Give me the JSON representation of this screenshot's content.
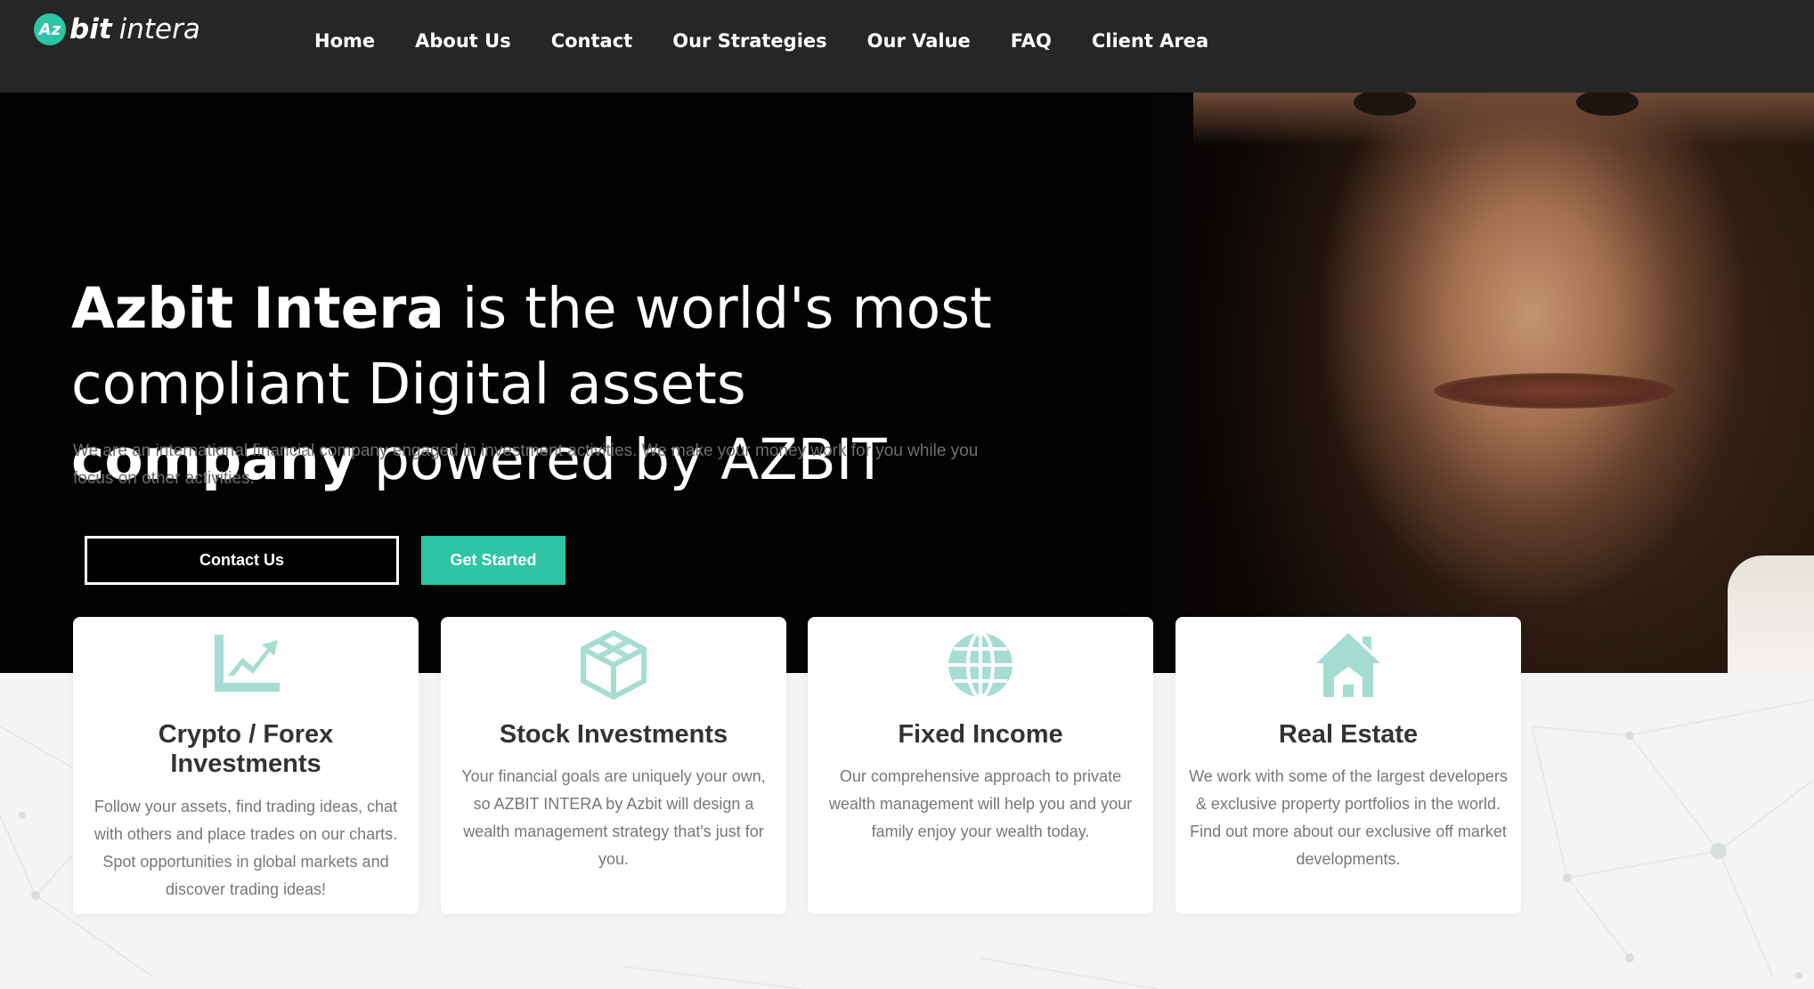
{
  "brand": {
    "badge": "Az",
    "name_bold": "bit",
    "name_light": "intera"
  },
  "nav": {
    "items": [
      "Home",
      "About Us",
      "Contact",
      "Our Strategies",
      "Our Value",
      "FAQ",
      "Client Area"
    ]
  },
  "hero": {
    "title_bold_1": "Azbit Intera",
    "title_text_1": " is the world's most compliant Digital assets ",
    "title_bold_2": "company",
    "title_text_2": " powered by AZBIT",
    "subtitle": "We are an international financial company engaged in investment activities. We make your money work for you while you focus on other activities.",
    "buttons": {
      "contact": "Contact Us",
      "start": "Get Started"
    }
  },
  "colors": {
    "accent": "#2ec4a6",
    "icon": "#a5ddd2",
    "navbar": "#262626",
    "hero_bg": "#030303"
  },
  "cards": [
    {
      "icon": "chart-growth-icon",
      "title": "Crypto / Forex Investments",
      "description": "Follow your assets, find trading ideas, chat with others and place trades on our charts. Spot opportunities in global markets and discover trading ideas!"
    },
    {
      "icon": "cube-icon",
      "title": "Stock Investments",
      "description": "Your financial goals are uniquely your own, so AZBIT INTERA by Azbit will design a wealth management strategy that's just for you."
    },
    {
      "icon": "globe-icon",
      "title": "Fixed Income",
      "description": "Our comprehensive approach to private wealth management will help you and your family enjoy your wealth today."
    },
    {
      "icon": "house-icon",
      "title": "Real Estate",
      "description": "We work with some of the largest developers & exclusive property portfolios in the world. Find out more about our exclusive off market developments."
    }
  ]
}
